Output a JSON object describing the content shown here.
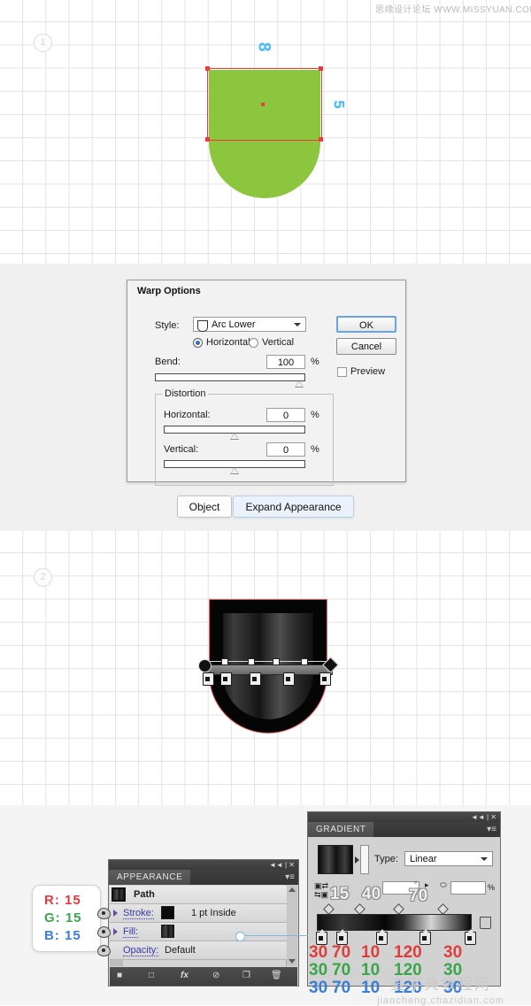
{
  "watermarks": {
    "top": "思缘设计论坛 WWW.MISSYUAN.COM",
    "bottom_cn": "查字典教程网",
    "bottom_en": "jiaocheng.chazidian.com"
  },
  "steps": {
    "one": "1",
    "two": "2"
  },
  "canvas1": {
    "shape_fill": "#8cc63e",
    "selection_color": "#ef3a3a",
    "marker_width": "8",
    "marker_height": "5"
  },
  "canvas2": {
    "shape_fill": "#050505",
    "selection_color": "#f05a5a"
  },
  "dialog": {
    "title": "Warp Options",
    "style_label": "Style:",
    "style_value": "Arc Lower",
    "horizontal_label": "Horizontal",
    "vertical_label": "Vertical",
    "orientation_selected": "Horizontal",
    "bend_label": "Bend:",
    "bend_value": "100",
    "bend_unit": "%",
    "distortion_label": "Distortion",
    "dist_h_label": "Horizontal:",
    "dist_h_value": "0",
    "dist_h_unit": "%",
    "dist_v_label": "Vertical:",
    "dist_v_value": "0",
    "dist_v_unit": "%",
    "ok_label": "OK",
    "cancel_label": "Cancel",
    "preview_label": "Preview",
    "preview_checked": false
  },
  "menubuttons": {
    "object": "Object",
    "expand_appearance": "Expand Appearance"
  },
  "appearance": {
    "tab_title": "APPEARANCE",
    "rows": [
      {
        "label": "Path",
        "value": ""
      },
      {
        "label": "Stroke:",
        "value": "1 pt  Inside"
      },
      {
        "label": "Fill:",
        "value": ""
      },
      {
        "label": "Opacity:",
        "value": "Default"
      }
    ],
    "footer_icons": [
      "fill-swatch-icon",
      "stroke-swatch-icon",
      "fx-icon",
      "clear-appearance-icon",
      "duplicate-item-icon",
      "delete-item-icon"
    ]
  },
  "rgb_callout": {
    "r_label": "R:",
    "r_value": "15",
    "g_label": "G:",
    "g_value": "15",
    "b_label": "B:",
    "b_value": "15",
    "r_color": "#e03c3c",
    "g_color": "#3aa54a",
    "b_color": "#3a7fd5"
  },
  "gradient": {
    "tab_title": "GRADIENT",
    "type_label": "Type:",
    "type_value": "Linear",
    "percent_unit": "%",
    "location_overlays": [
      "15",
      "40",
      "70"
    ],
    "stop_rgb": {
      "row_r": [
        "30",
        "70",
        "10",
        "120",
        "30"
      ],
      "row_g": [
        "30",
        "70",
        "10",
        "120",
        "30"
      ],
      "row_b": [
        "30",
        "70",
        "10",
        "120",
        "30"
      ],
      "r_color": "#e03c3c",
      "g_color": "#3aa54a",
      "b_color": "#3a7fd5"
    }
  },
  "chart_data": null
}
